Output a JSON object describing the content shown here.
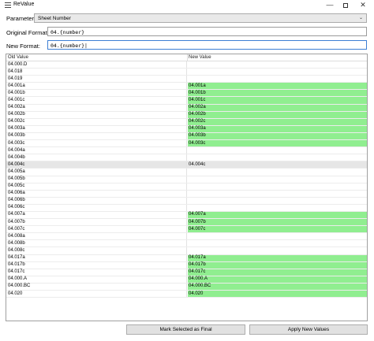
{
  "window": {
    "title": "ReValue"
  },
  "form": {
    "parameter_label": "Parameter:",
    "parameter_value": "Sheet Number",
    "original_label": "Original Format:",
    "original_value": "04.{number}",
    "new_label": "New Format:",
    "new_value": "04.{number}|"
  },
  "grid": {
    "col_old": "Old Value",
    "col_new": "New Value",
    "rows": [
      {
        "old": "04.000.D",
        "new": "",
        "changed": false,
        "selected": false
      },
      {
        "old": "04.018",
        "new": "",
        "changed": false,
        "selected": false
      },
      {
        "old": "04.019",
        "new": "",
        "changed": false,
        "selected": false
      },
      {
        "old": "04.001a",
        "new": "04.001a",
        "changed": true,
        "selected": false
      },
      {
        "old": "04.001b",
        "new": "04.001b",
        "changed": true,
        "selected": false
      },
      {
        "old": "04.001c",
        "new": "04.001c",
        "changed": true,
        "selected": false
      },
      {
        "old": "04.002a",
        "new": "04.002a",
        "changed": true,
        "selected": false
      },
      {
        "old": "04.002b",
        "new": "04.002b",
        "changed": true,
        "selected": false
      },
      {
        "old": "04.002c",
        "new": "04.002c",
        "changed": true,
        "selected": false
      },
      {
        "old": "04.003a",
        "new": "04.003a",
        "changed": true,
        "selected": false
      },
      {
        "old": "04.003b",
        "new": "04.003b",
        "changed": true,
        "selected": false
      },
      {
        "old": "04.003c",
        "new": "04.003c",
        "changed": true,
        "selected": false
      },
      {
        "old": "04.004a",
        "new": "",
        "changed": false,
        "selected": false
      },
      {
        "old": "04.004b",
        "new": "",
        "changed": false,
        "selected": false
      },
      {
        "old": "04.004c",
        "new": "04.004c",
        "changed": false,
        "selected": true
      },
      {
        "old": "04.005a",
        "new": "",
        "changed": false,
        "selected": false
      },
      {
        "old": "04.005b",
        "new": "",
        "changed": false,
        "selected": false
      },
      {
        "old": "04.005c",
        "new": "",
        "changed": false,
        "selected": false
      },
      {
        "old": "04.006a",
        "new": "",
        "changed": false,
        "selected": false
      },
      {
        "old": "04.006b",
        "new": "",
        "changed": false,
        "selected": false
      },
      {
        "old": "04.006c",
        "new": "",
        "changed": false,
        "selected": false
      },
      {
        "old": "04.007a",
        "new": "04.007a",
        "changed": true,
        "selected": false
      },
      {
        "old": "04.007b",
        "new": "04.007b",
        "changed": true,
        "selected": false
      },
      {
        "old": "04.007c",
        "new": "04.007c",
        "changed": true,
        "selected": false
      },
      {
        "old": "04.008a",
        "new": "",
        "changed": false,
        "selected": false
      },
      {
        "old": "04.008b",
        "new": "",
        "changed": false,
        "selected": false
      },
      {
        "old": "04.008c",
        "new": "",
        "changed": false,
        "selected": false
      },
      {
        "old": "04.017a",
        "new": "04.017a",
        "changed": true,
        "selected": false
      },
      {
        "old": "04.017b",
        "new": "04.017b",
        "changed": true,
        "selected": false
      },
      {
        "old": "04.017c",
        "new": "04.017c",
        "changed": true,
        "selected": false
      },
      {
        "old": "04.000.A",
        "new": "04.000.A",
        "changed": true,
        "selected": false
      },
      {
        "old": "04.000.BC",
        "new": "04.000.BC",
        "changed": true,
        "selected": false
      },
      {
        "old": "04.020",
        "new": "04.020",
        "changed": true,
        "selected": false
      }
    ]
  },
  "buttons": {
    "mark_final": "Mark Selected as Final",
    "apply": "Apply New Values"
  },
  "colors": {
    "changed_cell": "#90ee90",
    "selected_row": "#e6e6e6",
    "focus_border": "#3d7fd4"
  },
  "icons": {
    "app": "list-icon",
    "minimize": "minimize-icon",
    "maximize": "maximize-icon",
    "close": "close-icon",
    "dropdown": "chevron-down-icon"
  }
}
